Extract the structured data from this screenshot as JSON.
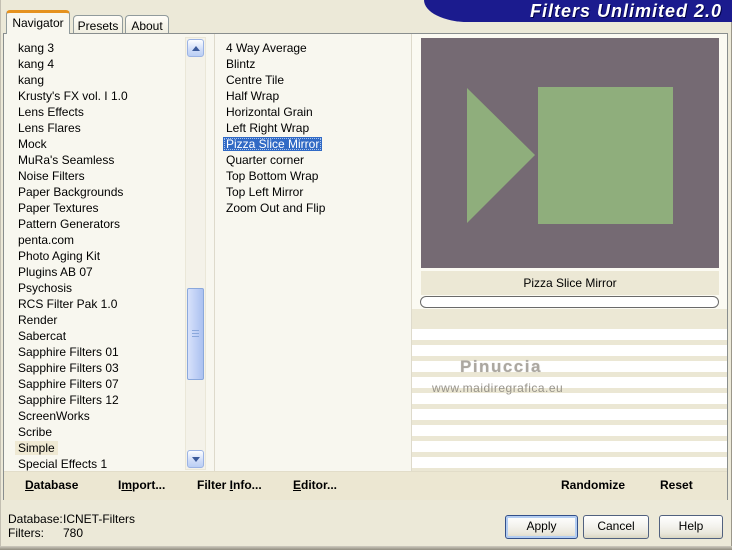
{
  "window": {
    "title": "Filters Unlimited 2.0"
  },
  "tabs": [
    {
      "label": "Navigator"
    },
    {
      "label": "Presets"
    },
    {
      "label": "About"
    }
  ],
  "category_list": {
    "selected_index": 25,
    "items": [
      "kang 3",
      "kang 4",
      "kang",
      "Krusty's FX vol. I 1.0",
      "Lens Effects",
      "Lens Flares",
      "Mock",
      "MuRa's Seamless",
      "Noise Filters",
      "Paper Backgrounds",
      "Paper Textures",
      "Pattern Generators",
      "penta.com",
      "Photo Aging Kit",
      "Plugins AB 07",
      "Psychosis",
      "RCS Filter Pak 1.0",
      "Render",
      "Sabercat",
      "Sapphire Filters 01",
      "Sapphire Filters 03",
      "Sapphire Filters 07",
      "Sapphire Filters 12",
      "ScreenWorks",
      "Scribe",
      "Simple",
      "Special Effects 1"
    ]
  },
  "filter_list": {
    "selected_index": 6,
    "items": [
      "4 Way Average",
      "Blintz",
      "Centre Tile",
      "Half Wrap",
      "Horizontal Grain",
      "Left Right Wrap",
      "Pizza Slice Mirror",
      "Quarter corner",
      "Top Bottom Wrap",
      "Top Left Mirror",
      "Zoom Out and Flip"
    ]
  },
  "preview": {
    "caption": "Pizza Slice Mirror",
    "bg_color": "#756a73",
    "shape_color": "#8fae7c",
    "watermark_line1": "Pinuccia",
    "watermark_line2": "www.maidiregrafica.eu"
  },
  "actions": {
    "database": {
      "pre": "",
      "key": "D",
      "post": "atabase"
    },
    "import": {
      "pre": "I",
      "key": "m",
      "post": "port..."
    },
    "filter_info": {
      "pre": "Filter ",
      "key": "I",
      "post": "nfo..."
    },
    "editor": {
      "pre": "",
      "key": "E",
      "post": "ditor..."
    },
    "randomize": "Randomize",
    "reset": "Reset"
  },
  "status": {
    "database_label": "Database:",
    "database_value": "ICNET-Filters",
    "filters_label": "Filters:",
    "filters_value": "780"
  },
  "footer": {
    "apply": "Apply",
    "cancel": "Cancel",
    "help": "Help"
  },
  "colors": {
    "banner": "#1b1b8e",
    "selection": "#316ac5",
    "dialog_bg": "#ece9d8"
  }
}
